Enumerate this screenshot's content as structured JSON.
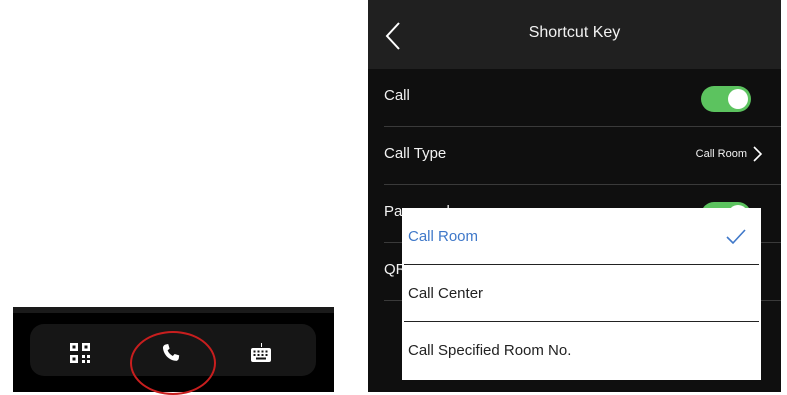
{
  "shortcut_bar": {
    "icons": [
      "qr-code-icon",
      "phone-icon",
      "keyboard-icon"
    ],
    "highlight_color": "#c81e1e"
  },
  "screen": {
    "title": "Shortcut Key",
    "rows": [
      {
        "label": "Call",
        "toggle": true
      },
      {
        "label": "Call Type",
        "value": "Call Room"
      },
      {
        "label": "Password",
        "toggle": true
      },
      {
        "label": "QR Code",
        "toggle": true
      }
    ],
    "accent_color": "#5cc35f"
  },
  "dropdown": {
    "options": [
      {
        "label": "Call Room",
        "selected": true
      },
      {
        "label": "Call Center",
        "selected": false
      },
      {
        "label": "Call Specified Room No.",
        "selected": false
      }
    ],
    "selected_color": "#3f78c9"
  }
}
